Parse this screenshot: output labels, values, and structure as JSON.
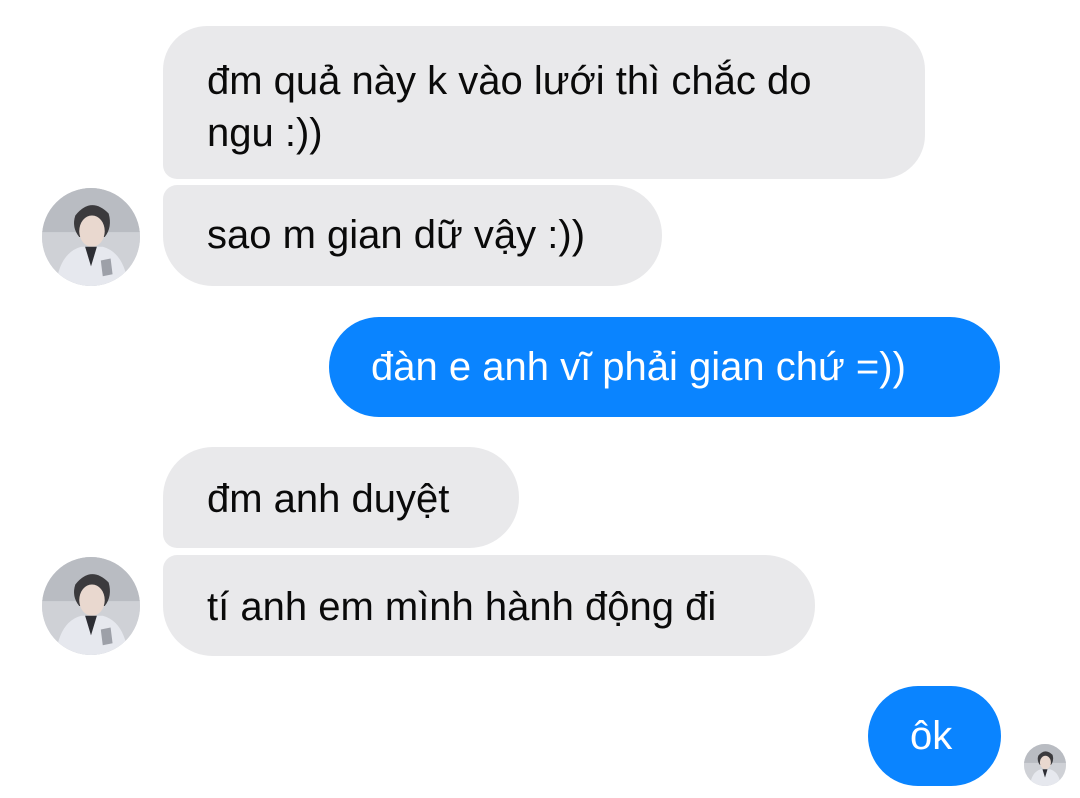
{
  "conversation": {
    "messages": [
      {
        "sender": "other",
        "text": "đm quả này k vào lưới thì chắc do ngu :))"
      },
      {
        "sender": "other",
        "text": "sao m gian dữ vậy :))"
      },
      {
        "sender": "me",
        "text": "đàn e anh vĩ phải gian chứ =))"
      },
      {
        "sender": "other",
        "text": "đm anh duyệt"
      },
      {
        "sender": "other",
        "text": "tí anh em mình hành động đi"
      },
      {
        "sender": "me",
        "text": "ôk"
      }
    ]
  },
  "theme": {
    "incoming_bubble": "#e9e9eb",
    "outgoing_bubble": "#0a84ff",
    "incoming_text": "#0a0a0a",
    "outgoing_text": "#ffffff"
  },
  "icons": {
    "avatar": "person-avatar-icon",
    "seen_indicator": "read-receipt-avatar-icon"
  }
}
